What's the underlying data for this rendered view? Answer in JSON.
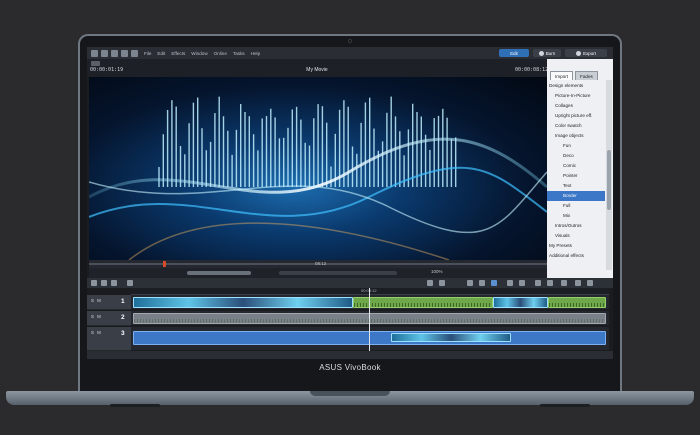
{
  "brand": "ASUS VivoBook",
  "menubar": {
    "items": [
      "File",
      "Edit",
      "Effects",
      "Window",
      "Online",
      "Tasks",
      "Help"
    ],
    "edit_label": "Edit",
    "burn_label": "Burn",
    "export_label": "Export"
  },
  "preview": {
    "title": "My Movie",
    "timecode_left": "00:00:01:19",
    "timecode_right": "00:00:08:12",
    "scrub_time": "08:12",
    "zoom": "100%"
  },
  "panel": {
    "tabs": [
      "Import",
      "Fades"
    ],
    "items": [
      {
        "label": "Design elements",
        "level": 0
      },
      {
        "label": "Picture-In-Picture",
        "level": 1
      },
      {
        "label": "Collages",
        "level": 1
      },
      {
        "label": "Upright picture eff.",
        "level": 1
      },
      {
        "label": "Color swatch",
        "level": 1
      },
      {
        "label": "Image objects",
        "level": 1
      },
      {
        "label": "Fun",
        "level": 2
      },
      {
        "label": "Deco",
        "level": 2
      },
      {
        "label": "Comic",
        "level": 2
      },
      {
        "label": "Pointer",
        "level": 2
      },
      {
        "label": "Text",
        "level": 2
      },
      {
        "label": "Border",
        "level": 2,
        "selected": true
      },
      {
        "label": "Full",
        "level": 2
      },
      {
        "label": "Mix",
        "level": 2
      },
      {
        "label": "Intros/Outros",
        "level": 1
      },
      {
        "label": "Visuals",
        "level": 1
      },
      {
        "label": "My Presets",
        "level": 0
      },
      {
        "label": "Additional effects",
        "level": 0
      }
    ]
  },
  "timeline": {
    "ruler_time": "00:08:12",
    "tracks": [
      {
        "controls": "S M",
        "label": "1"
      },
      {
        "controls": "S M",
        "label": "2"
      },
      {
        "controls": "S M",
        "label": "3"
      }
    ]
  },
  "colors": {
    "accent": "#2f6fb5",
    "selection": "#3c76c6",
    "clip_green": "#6fa84a",
    "clip_blue": "#3c78c6"
  }
}
